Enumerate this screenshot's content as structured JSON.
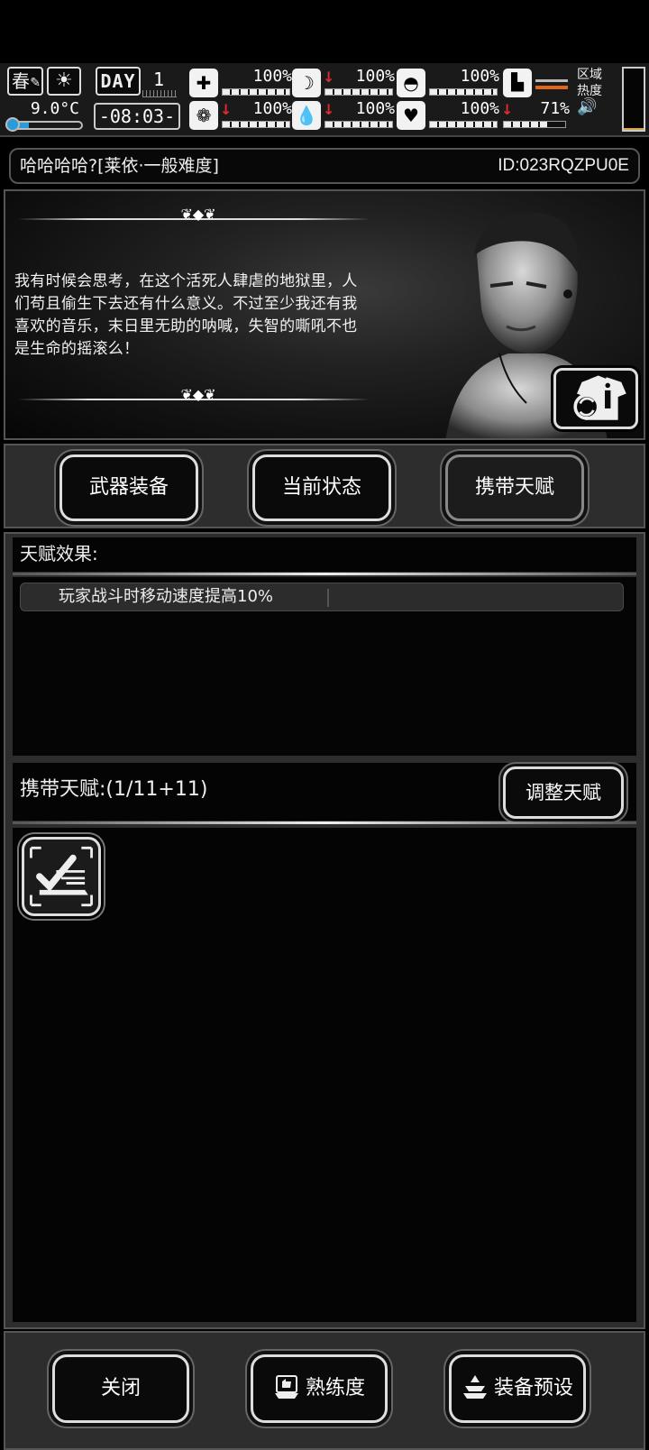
{
  "status_bar": {
    "season": "春",
    "temperature": "9.0°C",
    "day_label": "DAY",
    "day_number": "1",
    "clock": "-08:03-",
    "stats": [
      {
        "icon": "medkit-icon",
        "value": "100%",
        "trend_down": false
      },
      {
        "icon": "stomach-icon",
        "value": "100%",
        "trend_down": true
      },
      {
        "icon": "pill-icon",
        "value": "100%",
        "trend_down": false
      },
      {
        "icon": "brain-icon",
        "value": "100%",
        "trend_down": true
      },
      {
        "icon": "water-drop-icon",
        "value": "100%",
        "trend_down": true
      },
      {
        "icon": "heart-icon",
        "value": "100%",
        "trend_down": false
      },
      {
        "icon": "foot-icon",
        "value": "71%",
        "trend_down": true
      }
    ],
    "region_heat_label": "区域热度",
    "region_heat_level": 0.03,
    "accent_orange": "#e1661a",
    "temp_blue": "#2a9bd6",
    "down_arrow_red": "#e12b2b"
  },
  "header": {
    "name": "哈哈哈哈?[莱依·一般难度]",
    "player_id": "ID:023RQZPU0E"
  },
  "portrait": {
    "quote": "我有时候会思考，在这个活死人肆虐的地狱里，人们苟且偷生下去还有什么意义。不过至少我还有我喜欢的音乐，末日里无助的呐喊，失智的嘶吼不也是生命的摇滚么！"
  },
  "tabs": {
    "weapons": "武器装备",
    "status": "当前状态",
    "talents": "携带天赋"
  },
  "effects": {
    "title": "天赋效果:",
    "items": [
      "玩家战斗时移动速度提高10%"
    ]
  },
  "carry": {
    "label": "携带天赋:(1/11+11)",
    "adjust_button": "调整天赋"
  },
  "bottom": {
    "close": "关闭",
    "proficiency": "熟练度",
    "preset": "装备预设"
  }
}
